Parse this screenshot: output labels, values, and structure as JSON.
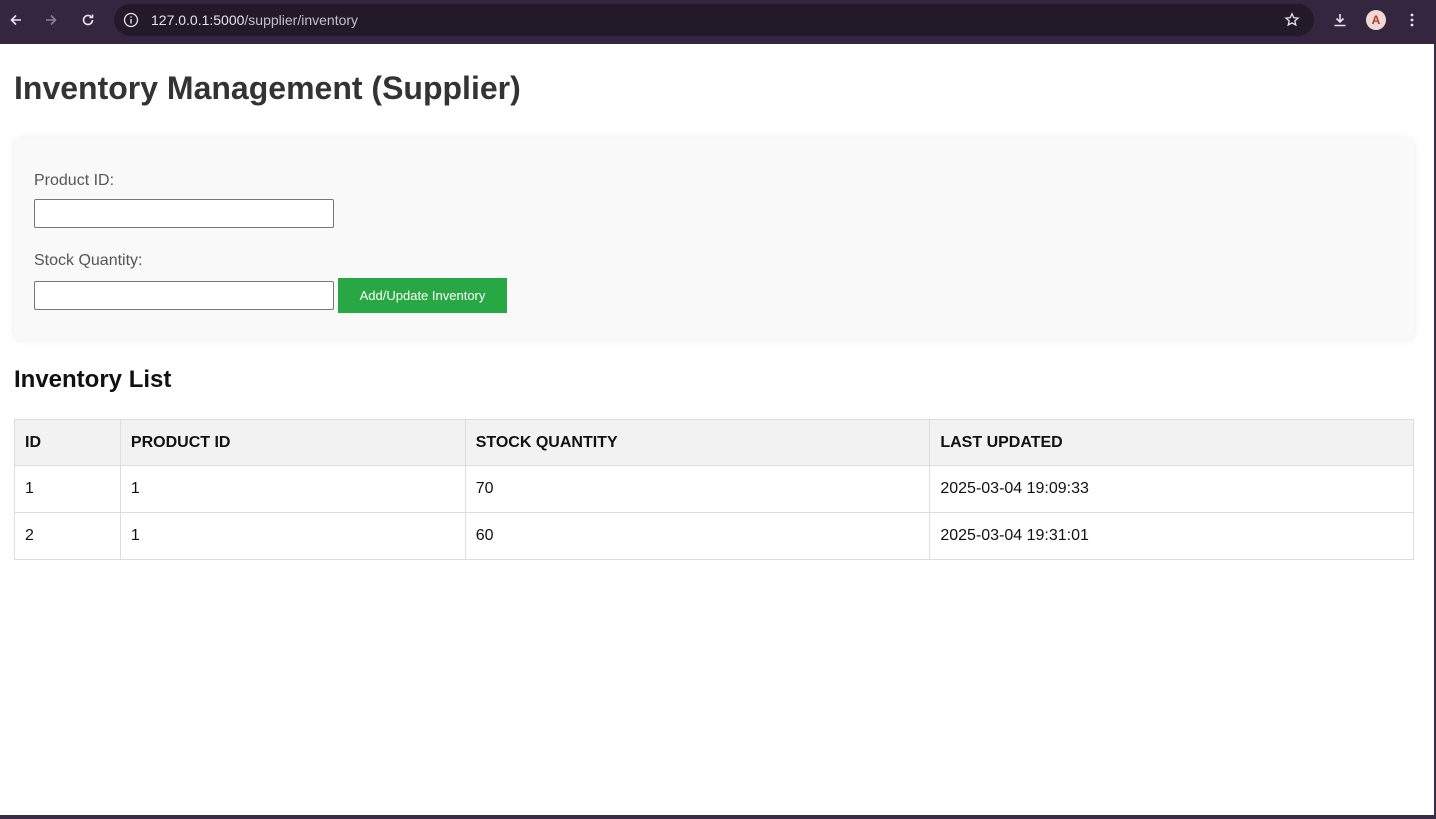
{
  "browser": {
    "url_host": "127.0.0.1:5000",
    "url_path": "/supplier/inventory",
    "icons": [
      "back-arrow-icon",
      "forward-arrow-icon",
      "reload-icon",
      "site-info-icon",
      "bookmark-star-icon",
      "download-icon",
      "profile-avatar",
      "kebab-menu-icon"
    ],
    "avatar_letter": "A"
  },
  "page": {
    "title": "Inventory Management (Supplier)"
  },
  "form": {
    "product_id_label": "Product ID:",
    "product_id_value": "",
    "stock_quantity_label": "Stock Quantity:",
    "stock_quantity_value": "",
    "submit_label": "Add/Update Inventory",
    "submit_color": "#28a745"
  },
  "inventory": {
    "section_title": "Inventory List",
    "columns": [
      "ID",
      "PRODUCT ID",
      "STOCK QUANTITY",
      "LAST UPDATED"
    ],
    "rows": [
      [
        "1",
        "1",
        "70",
        "2025-03-04 19:09:33"
      ],
      [
        "2",
        "1",
        "60",
        "2025-03-04 19:31:01"
      ]
    ]
  }
}
